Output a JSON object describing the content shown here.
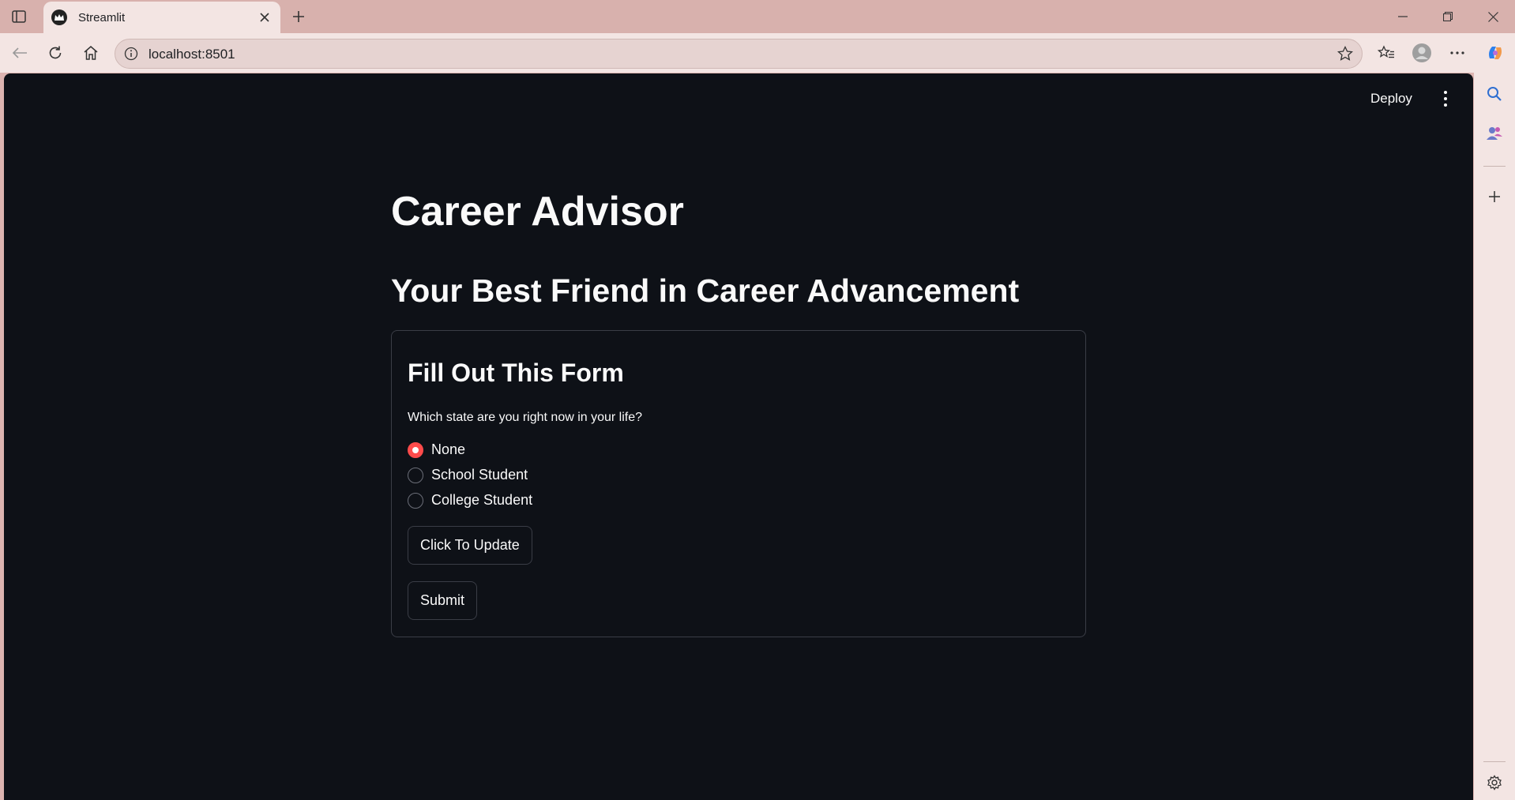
{
  "browser": {
    "tab_title": "Streamlit",
    "url": "localhost:8501"
  },
  "app": {
    "deploy_label": "Deploy",
    "title": "Career Advisor",
    "subtitle": "Your Best Friend in Career Advancement",
    "form": {
      "title": "Fill Out This Form",
      "question": "Which state are you right now in your life?",
      "options": [
        "None",
        "School Student",
        "College Student"
      ],
      "selected_option": "None",
      "update_button": "Click To Update",
      "submit_button": "Submit"
    }
  },
  "colors": {
    "accent": "#ff4b4b",
    "background": "#0e1117",
    "browser_chrome": "#f3e5e3"
  }
}
